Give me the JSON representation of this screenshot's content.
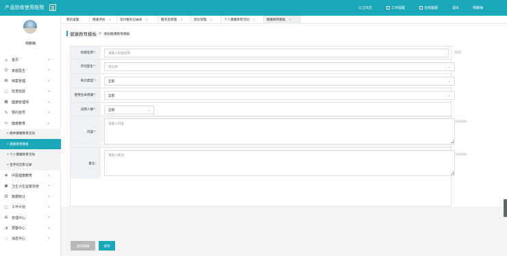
{
  "app": {
    "title": "产品验收使用医院"
  },
  "topnav": [
    {
      "label": "公卫日志"
    },
    {
      "label": "工作提醒"
    },
    {
      "label": "在线客服"
    },
    {
      "label": "退出"
    },
    {
      "label": "杨鹏梅"
    }
  ],
  "sidebar": {
    "username": "杨鹏梅",
    "items": [
      {
        "label": "首页",
        "icon": "home-icon"
      },
      {
        "label": "家庭医生",
        "icon": "user-icon"
      },
      {
        "label": "档案管理",
        "icon": "archive-icon"
      },
      {
        "label": "检查检验",
        "icon": "document-icon"
      },
      {
        "label": "健康管理师",
        "icon": "grid-icon"
      },
      {
        "label": "预约挂号",
        "icon": "pen-icon"
      },
      {
        "label": "健康教育",
        "icon": "book-icon"
      }
    ],
    "sub_items": [
      {
        "label": "• 群体健康教育活动"
      },
      {
        "label": "• 健康教育模板"
      },
      {
        "label": "• 个人健康教育活动"
      },
      {
        "label": "• 宣传社区影记录"
      }
    ],
    "items_after": [
      {
        "label": "中医健康教育",
        "icon": "medicine-icon"
      },
      {
        "label": "卫生计生监督协管",
        "icon": "shield-icon"
      },
      {
        "label": "数据统计",
        "icon": "chart-icon"
      },
      {
        "label": "工作计划",
        "icon": "calendar-icon"
      },
      {
        "label": "管理中心",
        "icon": "apps-icon"
      },
      {
        "label": "预警中心",
        "icon": "alert-icon"
      },
      {
        "label": "消息中心",
        "icon": "message-icon"
      }
    ]
  },
  "tabs": [
    {
      "label": "我的桌面"
    },
    {
      "label": "健康评估"
    },
    {
      "label": "签约服务记录表"
    },
    {
      "label": "服务包管理"
    },
    {
      "label": "团队管理"
    },
    {
      "label": "个人健康教育活动"
    },
    {
      "label": "健康教育模板"
    }
  ],
  "breadcrumb": {
    "current": "健康教育模板",
    "separator": ">",
    "page": "添加健康教育模板"
  },
  "form": {
    "title_label": "标题名称*：",
    "title_placeholder": "请输入标题名称",
    "title_count": "0/20",
    "doctor_label": "责任医生*：",
    "doctor_placeholder": "请选择",
    "knowledge_label": "知识类型*：",
    "knowledge_value": "全部",
    "lifecycle_label": "使用生命周期*：",
    "lifecycle_value": "全部",
    "crowd_label": "适用人群*：",
    "crowd_value": "全部",
    "content_label": "内容*：",
    "content_placeholder": "请输入内容",
    "content_count": "0/1000",
    "remark_label": "备注：",
    "remark_placeholder": "请输入备注",
    "remark_count": "0/1000"
  },
  "footer": {
    "back_label": "返回编辑",
    "save_label": "保存"
  },
  "colors": {
    "accent": "#1aa7b8",
    "label_bg": "#eef2f7",
    "disabled_button": "#b8b8b8"
  }
}
